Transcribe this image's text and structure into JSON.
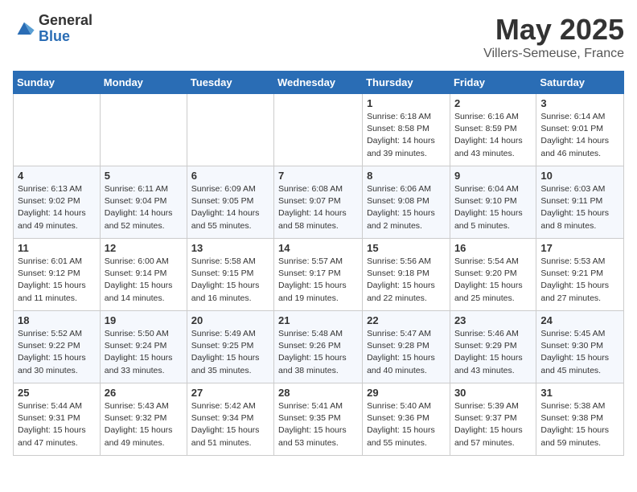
{
  "logo": {
    "general": "General",
    "blue": "Blue"
  },
  "title": "May 2025",
  "subtitle": "Villers-Semeuse, France",
  "days_of_week": [
    "Sunday",
    "Monday",
    "Tuesday",
    "Wednesday",
    "Thursday",
    "Friday",
    "Saturday"
  ],
  "weeks": [
    [
      {
        "day": "",
        "info": ""
      },
      {
        "day": "",
        "info": ""
      },
      {
        "day": "",
        "info": ""
      },
      {
        "day": "",
        "info": ""
      },
      {
        "day": "1",
        "info": "Sunrise: 6:18 AM\nSunset: 8:58 PM\nDaylight: 14 hours\nand 39 minutes."
      },
      {
        "day": "2",
        "info": "Sunrise: 6:16 AM\nSunset: 8:59 PM\nDaylight: 14 hours\nand 43 minutes."
      },
      {
        "day": "3",
        "info": "Sunrise: 6:14 AM\nSunset: 9:01 PM\nDaylight: 14 hours\nand 46 minutes."
      }
    ],
    [
      {
        "day": "4",
        "info": "Sunrise: 6:13 AM\nSunset: 9:02 PM\nDaylight: 14 hours\nand 49 minutes."
      },
      {
        "day": "5",
        "info": "Sunrise: 6:11 AM\nSunset: 9:04 PM\nDaylight: 14 hours\nand 52 minutes."
      },
      {
        "day": "6",
        "info": "Sunrise: 6:09 AM\nSunset: 9:05 PM\nDaylight: 14 hours\nand 55 minutes."
      },
      {
        "day": "7",
        "info": "Sunrise: 6:08 AM\nSunset: 9:07 PM\nDaylight: 14 hours\nand 58 minutes."
      },
      {
        "day": "8",
        "info": "Sunrise: 6:06 AM\nSunset: 9:08 PM\nDaylight: 15 hours\nand 2 minutes."
      },
      {
        "day": "9",
        "info": "Sunrise: 6:04 AM\nSunset: 9:10 PM\nDaylight: 15 hours\nand 5 minutes."
      },
      {
        "day": "10",
        "info": "Sunrise: 6:03 AM\nSunset: 9:11 PM\nDaylight: 15 hours\nand 8 minutes."
      }
    ],
    [
      {
        "day": "11",
        "info": "Sunrise: 6:01 AM\nSunset: 9:12 PM\nDaylight: 15 hours\nand 11 minutes."
      },
      {
        "day": "12",
        "info": "Sunrise: 6:00 AM\nSunset: 9:14 PM\nDaylight: 15 hours\nand 14 minutes."
      },
      {
        "day": "13",
        "info": "Sunrise: 5:58 AM\nSunset: 9:15 PM\nDaylight: 15 hours\nand 16 minutes."
      },
      {
        "day": "14",
        "info": "Sunrise: 5:57 AM\nSunset: 9:17 PM\nDaylight: 15 hours\nand 19 minutes."
      },
      {
        "day": "15",
        "info": "Sunrise: 5:56 AM\nSunset: 9:18 PM\nDaylight: 15 hours\nand 22 minutes."
      },
      {
        "day": "16",
        "info": "Sunrise: 5:54 AM\nSunset: 9:20 PM\nDaylight: 15 hours\nand 25 minutes."
      },
      {
        "day": "17",
        "info": "Sunrise: 5:53 AM\nSunset: 9:21 PM\nDaylight: 15 hours\nand 27 minutes."
      }
    ],
    [
      {
        "day": "18",
        "info": "Sunrise: 5:52 AM\nSunset: 9:22 PM\nDaylight: 15 hours\nand 30 minutes."
      },
      {
        "day": "19",
        "info": "Sunrise: 5:50 AM\nSunset: 9:24 PM\nDaylight: 15 hours\nand 33 minutes."
      },
      {
        "day": "20",
        "info": "Sunrise: 5:49 AM\nSunset: 9:25 PM\nDaylight: 15 hours\nand 35 minutes."
      },
      {
        "day": "21",
        "info": "Sunrise: 5:48 AM\nSunset: 9:26 PM\nDaylight: 15 hours\nand 38 minutes."
      },
      {
        "day": "22",
        "info": "Sunrise: 5:47 AM\nSunset: 9:28 PM\nDaylight: 15 hours\nand 40 minutes."
      },
      {
        "day": "23",
        "info": "Sunrise: 5:46 AM\nSunset: 9:29 PM\nDaylight: 15 hours\nand 43 minutes."
      },
      {
        "day": "24",
        "info": "Sunrise: 5:45 AM\nSunset: 9:30 PM\nDaylight: 15 hours\nand 45 minutes."
      }
    ],
    [
      {
        "day": "25",
        "info": "Sunrise: 5:44 AM\nSunset: 9:31 PM\nDaylight: 15 hours\nand 47 minutes."
      },
      {
        "day": "26",
        "info": "Sunrise: 5:43 AM\nSunset: 9:32 PM\nDaylight: 15 hours\nand 49 minutes."
      },
      {
        "day": "27",
        "info": "Sunrise: 5:42 AM\nSunset: 9:34 PM\nDaylight: 15 hours\nand 51 minutes."
      },
      {
        "day": "28",
        "info": "Sunrise: 5:41 AM\nSunset: 9:35 PM\nDaylight: 15 hours\nand 53 minutes."
      },
      {
        "day": "29",
        "info": "Sunrise: 5:40 AM\nSunset: 9:36 PM\nDaylight: 15 hours\nand 55 minutes."
      },
      {
        "day": "30",
        "info": "Sunrise: 5:39 AM\nSunset: 9:37 PM\nDaylight: 15 hours\nand 57 minutes."
      },
      {
        "day": "31",
        "info": "Sunrise: 5:38 AM\nSunset: 9:38 PM\nDaylight: 15 hours\nand 59 minutes."
      }
    ]
  ]
}
